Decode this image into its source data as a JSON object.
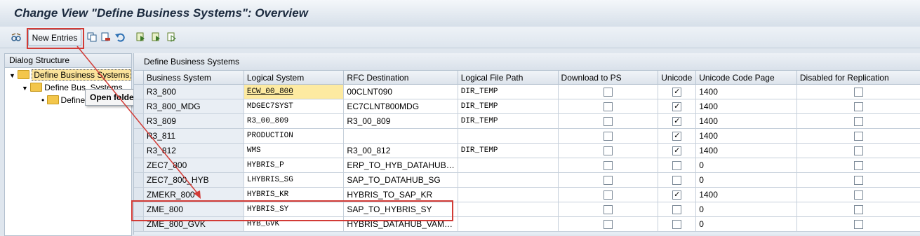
{
  "window": {
    "title": "Change View \"Define Business Systems\": Overview"
  },
  "toolbar": {
    "new_entries_label": "New Entries",
    "icons": [
      "glasses-icon",
      "copy-icon",
      "delete-icon",
      "undo-icon",
      "select-all-icon",
      "select-block-icon",
      "deselect-icon"
    ]
  },
  "dialog_structure": {
    "header": "Dialog Structure",
    "items": [
      {
        "label": "Define Business Systems",
        "level": 0
      },
      {
        "label": "Define Bus. Systems,",
        "level": 1
      },
      {
        "label": "Define",
        "level": 2
      }
    ],
    "tooltip": "Open folder"
  },
  "table": {
    "section_title": "Define Business Systems",
    "columns": [
      "Business System",
      "Logical System",
      "RFC Destination",
      "Logical File Path",
      "Download to PS",
      "Unicode",
      "Unicode Code Page",
      "Disabled for Replication"
    ],
    "rows": [
      {
        "business_system": "R3_800",
        "logical_system": "ECW_00_800",
        "rfc_destination": "00CLNT090",
        "file_path": "DIR_TEMP",
        "download": false,
        "unicode": true,
        "code_page": "1400",
        "disabled": false
      },
      {
        "business_system": "R3_800_MDG",
        "logical_system": "MDGEC7SYST",
        "rfc_destination": "EC7CLNT800MDG",
        "file_path": "DIR_TEMP",
        "download": false,
        "unicode": true,
        "code_page": "1400",
        "disabled": false
      },
      {
        "business_system": "R3_809",
        "logical_system": "R3_00_809",
        "rfc_destination": "R3_00_809",
        "file_path": "DIR_TEMP",
        "download": false,
        "unicode": true,
        "code_page": "1400",
        "disabled": false
      },
      {
        "business_system": "R3_811",
        "logical_system": "PRODUCTION",
        "rfc_destination": "",
        "file_path": "",
        "download": false,
        "unicode": true,
        "code_page": "1400",
        "disabled": false
      },
      {
        "business_system": "R3_812",
        "logical_system": "WMS",
        "rfc_destination": "R3_00_812",
        "file_path": "DIR_TEMP",
        "download": false,
        "unicode": true,
        "code_page": "1400",
        "disabled": false
      },
      {
        "business_system": "ZEC7_800",
        "logical_system": "HYBRIS_P",
        "rfc_destination": "ERP_TO_HYB_DATAHUB…",
        "file_path": "",
        "download": false,
        "unicode": false,
        "code_page": "0",
        "disabled": false
      },
      {
        "business_system": "ZEC7_800_HYB",
        "logical_system": "LHYBRIS_SG",
        "rfc_destination": "SAP_TO_DATAHUB_SG",
        "file_path": "",
        "download": false,
        "unicode": false,
        "code_page": "0",
        "disabled": false
      },
      {
        "business_system": "ZMEKR_800",
        "logical_system": "HYBRIS_KR",
        "rfc_destination": "HYBRIS_TO_SAP_KR",
        "file_path": "",
        "download": false,
        "unicode": true,
        "code_page": "1400",
        "disabled": false
      },
      {
        "business_system": "ZME_800",
        "logical_system": "HYBRIS_SY",
        "rfc_destination": "SAP_TO_HYBRIS_SY",
        "file_path": "",
        "download": false,
        "unicode": false,
        "code_page": "0",
        "disabled": false
      },
      {
        "business_system": "ZME_800_GVK",
        "logical_system": "HYB_GVK",
        "rfc_destination": "HYBRIS_DATAHUB_VAM…",
        "file_path": "",
        "download": false,
        "unicode": false,
        "code_page": "0",
        "disabled": false
      }
    ]
  },
  "colors": {
    "annotation": "#d23b36",
    "selected_cell": "#fdeaa1"
  }
}
